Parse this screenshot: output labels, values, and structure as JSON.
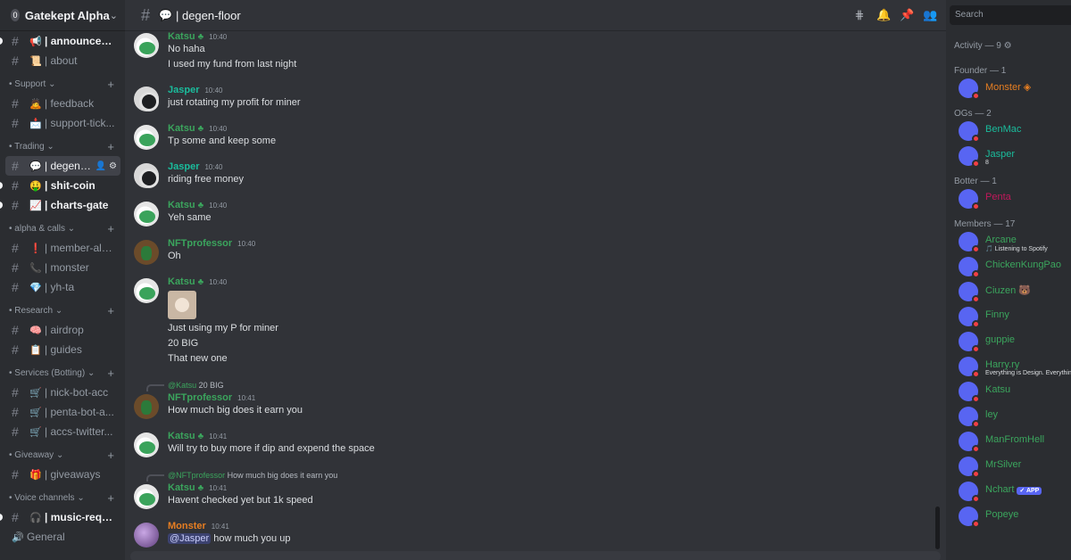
{
  "server": {
    "notification_count": "0",
    "name": "Gatekept Alpha"
  },
  "sidebar": {
    "top_channels": [
      {
        "emoji": "📢",
        "label": "| announceme...",
        "unread": true
      },
      {
        "emoji": "📜",
        "label": "| about",
        "unread": false
      }
    ],
    "categories": [
      {
        "label": "• Support ⌄",
        "channels": [
          {
            "emoji": "🙇",
            "label": "| feedback",
            "unread": false
          },
          {
            "emoji": "📩",
            "label": "| support-tick...",
            "unread": false
          }
        ]
      },
      {
        "label": "• Trading ⌄",
        "channels": [
          {
            "emoji": "💬",
            "label": "| degen-...",
            "unread": false,
            "active": true
          },
          {
            "emoji": "🤑",
            "label": "| shit-coin",
            "unread": true
          },
          {
            "emoji": "📈",
            "label": "| charts-gate",
            "unread": true
          }
        ]
      },
      {
        "label": "• alpha & calls ⌄",
        "channels": [
          {
            "emoji": "❗",
            "label": "| member-alpha",
            "unread": false
          },
          {
            "emoji": "📞",
            "label": "| monster",
            "unread": false
          },
          {
            "emoji": "💎",
            "label": "| yh-ta",
            "unread": false
          }
        ]
      },
      {
        "label": "• Research ⌄",
        "channels": [
          {
            "emoji": "🧠",
            "label": "| airdrop",
            "unread": false
          },
          {
            "emoji": "📋",
            "label": "| guides",
            "unread": false
          }
        ]
      },
      {
        "label": "• Services (Botting) ⌄",
        "channels": [
          {
            "emoji": "🛒",
            "label": "| nick-bot-acc",
            "unread": false
          },
          {
            "emoji": "🛒",
            "label": "| penta-bot-a...",
            "unread": false
          },
          {
            "emoji": "🛒",
            "label": "| accs-twitter...",
            "unread": false
          }
        ]
      },
      {
        "label": "• Giveaway ⌄",
        "channels": [
          {
            "emoji": "🎁",
            "label": "| giveaways",
            "unread": false
          }
        ]
      },
      {
        "label": "• Voice channels ⌄",
        "channels": [
          {
            "emoji": "🎧",
            "label": "| music-reque...",
            "unread": true
          },
          {
            "emoji": "🔊",
            "label": "General",
            "unread": false,
            "voice": true
          }
        ]
      }
    ]
  },
  "header": {
    "emoji": "💬",
    "title": "| degen-floor",
    "icons": [
      "threads-icon",
      "bell-icon",
      "pin-icon",
      "members-icon"
    ]
  },
  "search": {
    "placeholder": "Search"
  },
  "messages": [
    {
      "author": "Katsu",
      "color": "green",
      "badge": true,
      "time": "10:40",
      "lines": [
        "No haha",
        "I used my fund from last night"
      ]
    },
    {
      "author": "Jasper",
      "color": "teal",
      "badge": false,
      "time": "10:40",
      "lines": [
        "just rotating my profit for miner"
      ]
    },
    {
      "author": "Katsu",
      "color": "green",
      "badge": true,
      "time": "10:40",
      "lines": [
        "Tp some and keep some"
      ]
    },
    {
      "author": "Jasper",
      "color": "teal",
      "badge": false,
      "time": "10:40",
      "lines": [
        "riding free money"
      ]
    },
    {
      "author": "Katsu",
      "color": "green",
      "badge": true,
      "time": "10:40",
      "lines": [
        "Yeh same"
      ]
    },
    {
      "author": "NFTprofessor",
      "color": "green",
      "badge": false,
      "time": "10:40",
      "lines": [
        "Oh"
      ]
    },
    {
      "author": "Katsu",
      "color": "green",
      "badge": true,
      "time": "10:40",
      "lines": [
        "Just using my P for miner",
        "20 BIG",
        "That new one"
      ],
      "has_image": true
    },
    {
      "author": "NFTprofessor",
      "color": "green",
      "badge": false,
      "time": "10:41",
      "lines": [
        "How much big does it earn you"
      ],
      "reply_to": "@Katsu",
      "reply_text": "20 BIG"
    },
    {
      "author": "Katsu",
      "color": "green",
      "badge": true,
      "time": "10:41",
      "lines": [
        "Will try to buy more if dip and expend the space"
      ]
    },
    {
      "author": "Katsu",
      "color": "green",
      "badge": true,
      "time": "10:41",
      "lines": [
        "Havent checked yet but 1k speed"
      ],
      "reply_to": "@NFTprofessor",
      "reply_text": "How much big does it earn you"
    },
    {
      "author": "Monster",
      "color": "orange",
      "badge": false,
      "time": "10:41",
      "lines": [
        "how much you up"
      ],
      "mention": "@Jasper"
    }
  ],
  "member_list": {
    "activity": "Activity — 9 ⚙",
    "sections": [
      {
        "title": "Founder — 1",
        "members": [
          {
            "name": "Monster",
            "color": "#e67e22",
            "suffix": "◈"
          }
        ]
      },
      {
        "title": "OGs — 2",
        "members": [
          {
            "name": "BenMac",
            "color": "#1abc9c"
          },
          {
            "name": "Jasper",
            "color": "#1abc9c",
            "status": "8"
          }
        ]
      },
      {
        "title": "Botter — 1",
        "members": [
          {
            "name": "Penta",
            "color": "#c2185b"
          }
        ]
      },
      {
        "title": "Members — 17",
        "members": [
          {
            "name": "Arcane",
            "color": "#3ba55d",
            "status": "🎵 Listening to Spotify"
          },
          {
            "name": "ChickenKungPao",
            "color": "#3ba55d"
          },
          {
            "name": "Ciuzen",
            "color": "#3ba55d",
            "suffix": "🐻"
          },
          {
            "name": "Finny",
            "color": "#3ba55d"
          },
          {
            "name": "guppie",
            "color": "#3ba55d"
          },
          {
            "name": "Harry.ry",
            "color": "#3ba55d",
            "status": "Everything is Design. Everything"
          },
          {
            "name": "Katsu",
            "color": "#3ba55d"
          },
          {
            "name": "ley",
            "color": "#3ba55d"
          },
          {
            "name": "ManFromHell",
            "color": "#3ba55d"
          },
          {
            "name": "MrSilver",
            "color": "#3ba55d"
          },
          {
            "name": "Nchart",
            "color": "#3ba55d",
            "app_badge": "✓ APP"
          },
          {
            "name": "Popeye",
            "color": "#3ba55d"
          }
        ]
      }
    ]
  }
}
